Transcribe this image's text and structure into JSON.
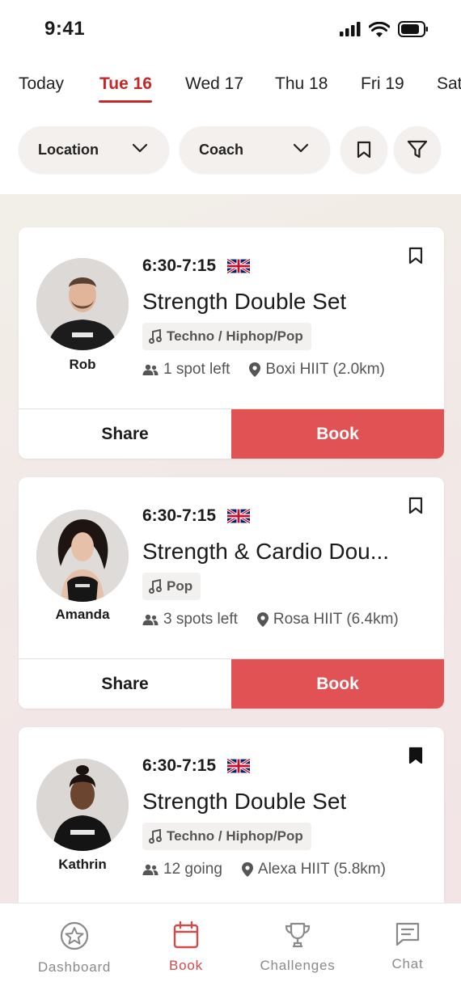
{
  "status_bar": {
    "time": "9:41"
  },
  "dates": [
    "Today",
    "Tue 16",
    "Wed 17",
    "Thu 18",
    "Fri 19",
    "Sat"
  ],
  "filters": {
    "location": "Location",
    "coach": "Coach"
  },
  "classes": [
    {
      "coach": "Rob",
      "time": "6:30-7:15",
      "title": "Strength Double Set",
      "music": "Techno / Hiphop/Pop",
      "spots": "1 spot left",
      "location": "Boxi HIIT (2.0km)",
      "bookmarked": false
    },
    {
      "coach": "Amanda",
      "time": "6:30-7:15",
      "title": "Strength & Cardio Dou...",
      "music": "Pop",
      "spots": "3 spots left",
      "location": "Rosa HIIT (6.4km)",
      "bookmarked": false
    },
    {
      "coach": "Kathrin",
      "time": "6:30-7:15",
      "title": "Strength Double Set",
      "music": "Techno / Hiphop/Pop",
      "spots": "12 going",
      "location": "Alexa HIIT (5.8km)",
      "bookmarked": true
    }
  ],
  "actions": {
    "share": "Share",
    "book": "Book"
  },
  "tabbar": {
    "dashboard": "Dashboard",
    "book": "Book",
    "challenges": "Challenges",
    "chat": "Chat"
  },
  "colors": {
    "accent": "#c62828",
    "book_button": "#e05254"
  }
}
